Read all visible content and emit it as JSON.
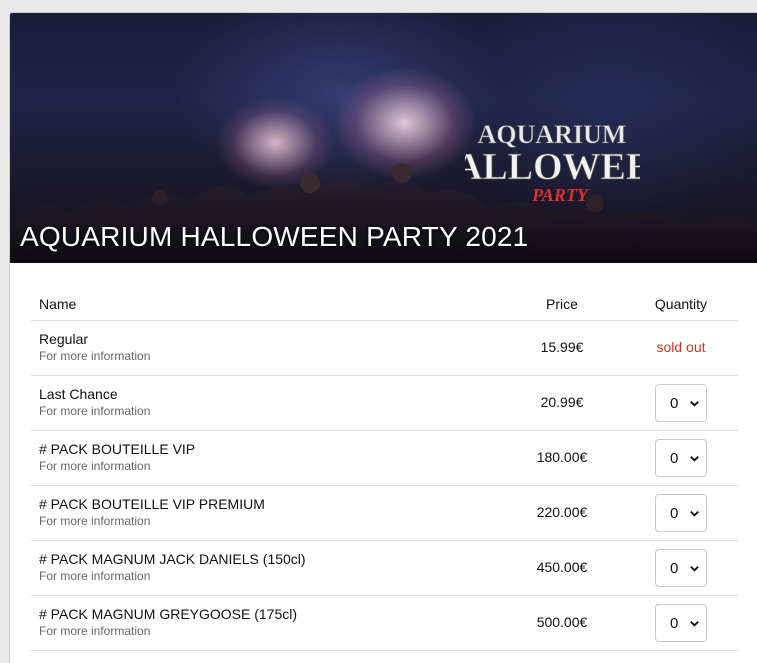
{
  "event": {
    "title": "AQUARIUM HALLOWEEN PARTY 2021",
    "logo_text": [
      "AQUARIUM",
      "HALLOWEEN",
      "PARTY"
    ]
  },
  "table": {
    "headers": {
      "name": "Name",
      "price": "Price",
      "quantity": "Quantity"
    },
    "tickets": [
      {
        "name": "Regular",
        "info": "For more information",
        "price": "15.99€",
        "status": "sold out",
        "quantity": null
      },
      {
        "name": "Last Chance",
        "info": "For more information",
        "price": "20.99€",
        "status": null,
        "quantity": "0"
      },
      {
        "name": "# PACK BOUTEILLE VIP",
        "info": "For more information",
        "price": "180.00€",
        "status": null,
        "quantity": "0"
      },
      {
        "name": "# PACK BOUTEILLE VIP PREMIUM",
        "info": "For more information",
        "price": "220.00€",
        "status": null,
        "quantity": "0"
      },
      {
        "name": "# PACK MAGNUM JACK DANIELS (150cl)",
        "info": "For more information",
        "price": "450.00€",
        "status": null,
        "quantity": "0"
      },
      {
        "name": "# PACK MAGNUM GREYGOOSE (175cl)",
        "info": "For more information",
        "price": "500.00€",
        "status": null,
        "quantity": "0"
      }
    ]
  },
  "colors": {
    "sold_out": "#c0392b",
    "border": "#dcdcdc"
  },
  "icons": {
    "select_arrow": "chevron-down-icon"
  }
}
